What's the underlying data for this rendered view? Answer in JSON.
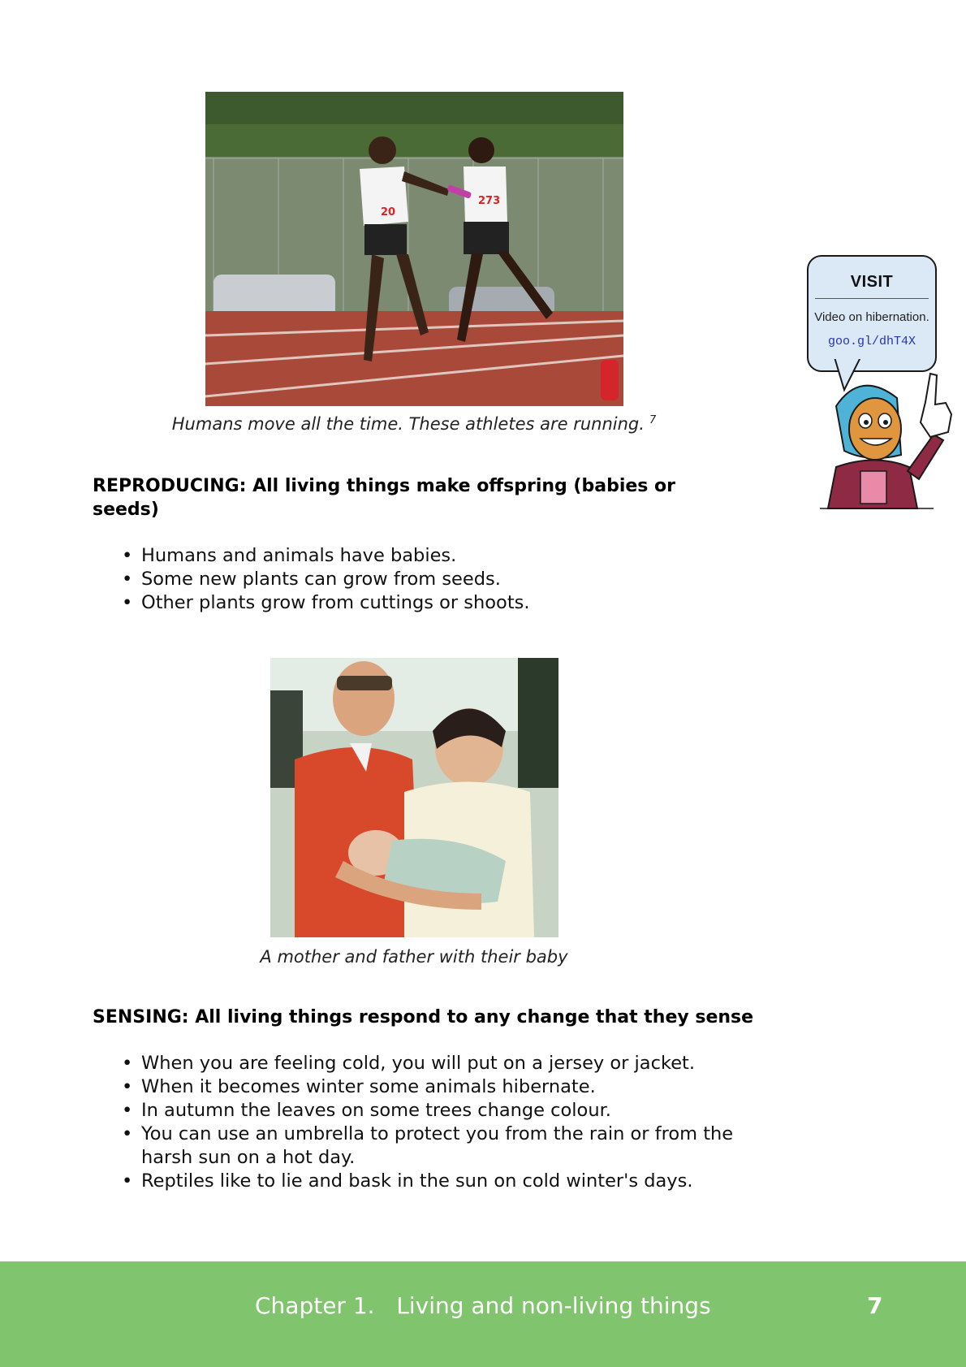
{
  "figures": [
    {
      "caption": "Humans move all the time.  These athletes are running.",
      "footnote": "7"
    },
    {
      "caption": "A mother and father with their baby"
    }
  ],
  "sections": [
    {
      "heading": "REPRODUCING: All living things make offspring (babies or seeds)",
      "bullets": [
        "Humans and animals have babies.",
        "Some new plants can grow from seeds.",
        "Other plants grow from cuttings or shoots."
      ]
    },
    {
      "heading": "SENSING: All living things respond to any change that they sense",
      "bullets": [
        "When you are feeling cold, you will put on a jersey or jacket.",
        "When it becomes winter some animals hibernate.",
        "In autumn the leaves on some trees change colour.",
        "You can use an umbrella to protect you from the rain or from the harsh sun on a hot day.",
        "Reptiles like to lie and bask in the sun on cold winter's days."
      ]
    }
  ],
  "visit": {
    "title": "VISIT",
    "text": "Video on hibernation.",
    "link": "goo.gl/dhT4X"
  },
  "footer": {
    "chapter": "Chapter 1.   Living and non-living things",
    "page": "7"
  },
  "colors": {
    "footer_bg": "#80c46e",
    "visit_bg": "#dbe9f6",
    "link": "#2233bb"
  }
}
